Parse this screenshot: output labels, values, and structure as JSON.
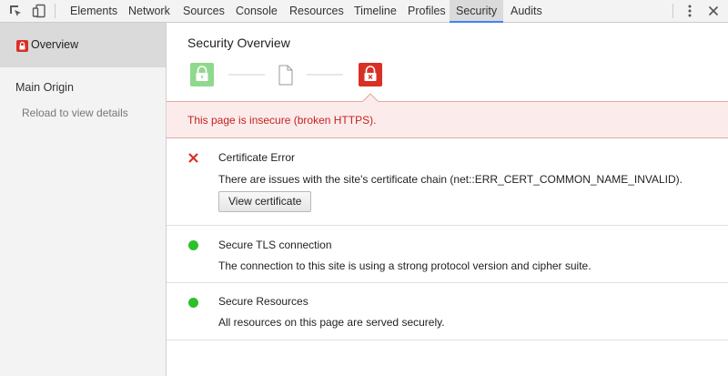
{
  "toolbar": {
    "tabs": [
      "Elements",
      "Network",
      "Sources",
      "Console",
      "Resources",
      "Timeline",
      "Profiles",
      "Security",
      "Audits"
    ],
    "selected_tab": "Security",
    "icons": [
      "inspect-element-icon",
      "device-mode-icon",
      "more-options-icon",
      "close-icon"
    ]
  },
  "sidebar": {
    "overview_label": "Overview",
    "main_origin_label": "Main Origin",
    "reload_hint": "Reload to view details"
  },
  "main": {
    "title": "Security Overview",
    "banner_text": "This page is insecure (broken HTTPS).",
    "sections": [
      {
        "title": "Certificate Error",
        "description": "There are issues with the site's certificate chain (net::ERR_CERT_COMMON_NAME_INVALID).",
        "button_label": "View certificate",
        "status": "error"
      },
      {
        "title": "Secure TLS connection",
        "description": "The connection to this site is using a strong protocol version and cipher suite.",
        "status": "secure"
      },
      {
        "title": "Secure Resources",
        "description": "All resources on this page are served securely.",
        "status": "secure"
      }
    ]
  },
  "colors": {
    "secure": "#2cc02c",
    "insecure": "#d93025",
    "neutral_lock": "#8fd98f",
    "accent": "#3e82f7"
  }
}
